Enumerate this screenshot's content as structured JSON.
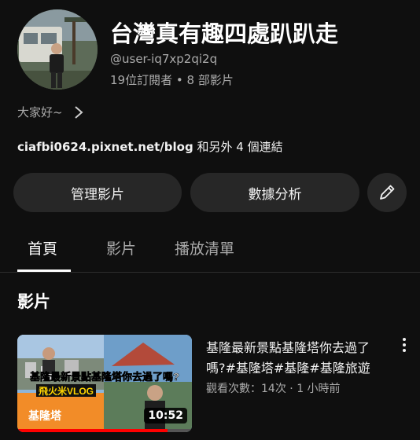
{
  "channel": {
    "name": "台灣真有趣四處趴趴走",
    "handle": "@user-iq7xp2qi2q",
    "subscribers": "19位訂閱者",
    "separator": "•",
    "video_count": "8 部影片",
    "description": "大家好~",
    "link_url": "ciafbi0624.pixnet.net/blog",
    "link_more": " 和另外 4 個連結"
  },
  "buttons": {
    "manage": "管理影片",
    "analytics": "數據分析",
    "edit_icon": "pencil-icon"
  },
  "tabs": [
    {
      "label": "首頁",
      "active": true
    },
    {
      "label": "影片",
      "active": false
    },
    {
      "label": "播放清單",
      "active": false
    }
  ],
  "section": {
    "title": "影片"
  },
  "video": {
    "title": "基隆最新景點基隆塔你去過了嗎?#基隆塔#基隆#基隆旅遊",
    "views": "觀看次數：14次",
    "separator": "·",
    "age": "1 小時前",
    "duration": "10:52",
    "progress_fraction": 0.86,
    "thumb_caption": "基隆最新景點基隆塔你去過了嗎?",
    "thumb_brand": "飛火米VLOG",
    "thumb_sign": "基隆塔"
  },
  "colors": {
    "background": "#0f0f0f",
    "button": "#272727",
    "progress": "#ff0000",
    "secondary_text": "#aaaaaa"
  }
}
